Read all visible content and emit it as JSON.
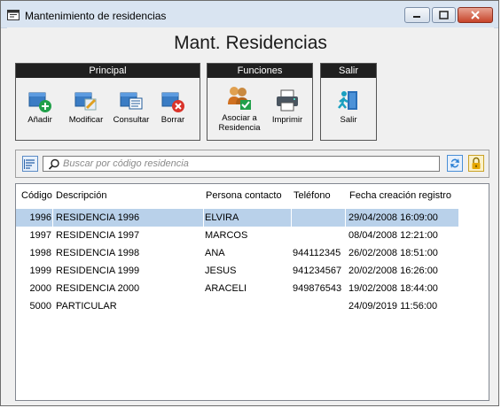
{
  "window": {
    "title": "Mantenimiento de residencias"
  },
  "heading": "Mant. Residencias",
  "ribbon": {
    "principal": {
      "title": "Principal",
      "buttons": [
        {
          "label": "Añadir",
          "icon": "add-icon"
        },
        {
          "label": "Modificar",
          "icon": "edit-icon"
        },
        {
          "label": "Consultar",
          "icon": "view-icon"
        },
        {
          "label": "Borrar",
          "icon": "delete-icon"
        }
      ]
    },
    "funciones": {
      "title": "Funciones",
      "buttons": [
        {
          "label": "Asociar a Residencia",
          "icon": "users-link-icon"
        },
        {
          "label": "Imprimir",
          "icon": "printer-icon"
        }
      ]
    },
    "salir": {
      "title": "Salir",
      "buttons": [
        {
          "label": "Salir",
          "icon": "exit-icon"
        }
      ]
    }
  },
  "search": {
    "placeholder": "Buscar por código residencia",
    "value": ""
  },
  "table": {
    "columns": [
      "Código",
      "Descripción",
      "Persona contacto",
      "Teléfono",
      "Fecha creación registro"
    ],
    "rows": [
      {
        "code": "1996",
        "desc": "RESIDENCIA 1996",
        "contact": "ELVIRA",
        "phone": "",
        "date": "29/04/2008 16:09:00",
        "selected": true
      },
      {
        "code": "1997",
        "desc": "RESIDENCIA 1997",
        "contact": "MARCOS",
        "phone": "",
        "date": "08/04/2008 12:21:00"
      },
      {
        "code": "1998",
        "desc": "RESIDENCIA 1998",
        "contact": "ANA",
        "phone": "944112345",
        "date": "26/02/2008 18:51:00"
      },
      {
        "code": "1999",
        "desc": "RESIDENCIA 1999",
        "contact": "JESUS",
        "phone": "941234567",
        "date": "20/02/2008 16:26:00"
      },
      {
        "code": "2000",
        "desc": "RESIDENCIA 2000",
        "contact": "ARACELI",
        "phone": "949876543",
        "date": "19/02/2008 18:44:00"
      },
      {
        "code": "5000",
        "desc": "PARTICULAR",
        "contact": "",
        "phone": "",
        "date": "24/09/2019 11:56:00"
      }
    ]
  },
  "colors": {
    "selected_row": "#b9d1ea",
    "group_header": "#202020",
    "titlebar": "#d9e4f1"
  }
}
